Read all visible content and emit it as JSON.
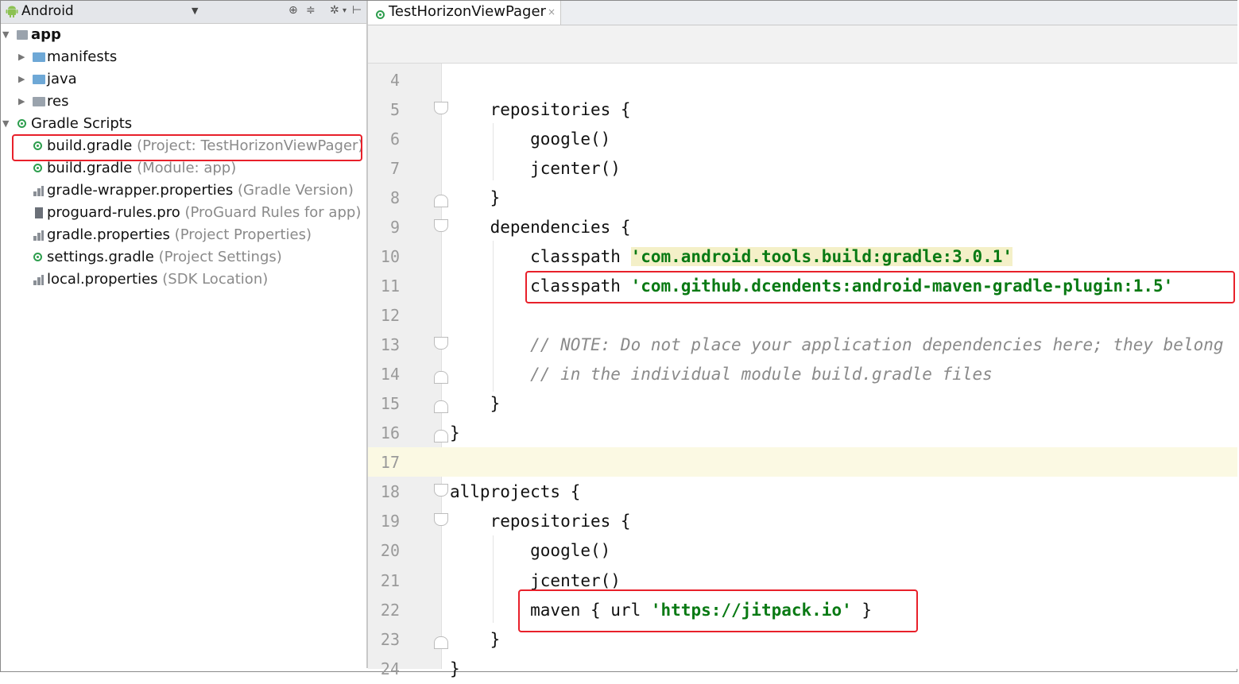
{
  "project_panel": {
    "view_label": "Android",
    "tree": [
      {
        "label": "app",
        "hint": "",
        "icon": "app-module-icon"
      },
      {
        "label": "manifests",
        "hint": "",
        "icon": "folder-icon"
      },
      {
        "label": "java",
        "hint": "",
        "icon": "folder-icon"
      },
      {
        "label": "res",
        "hint": "",
        "icon": "res-folder-icon"
      },
      {
        "label": "Gradle Scripts",
        "hint": "",
        "icon": "gradle-icon"
      },
      {
        "label": "build.gradle",
        "hint": "(Project: TestHorizonViewPager)",
        "icon": "gradle-icon"
      },
      {
        "label": "build.gradle",
        "hint": "(Module: app)",
        "icon": "gradle-icon"
      },
      {
        "label": "gradle-wrapper.properties",
        "hint": "(Gradle Version)",
        "icon": "properties-icon"
      },
      {
        "label": "proguard-rules.pro",
        "hint": "(ProGuard Rules for app)",
        "icon": "file-icon"
      },
      {
        "label": "gradle.properties",
        "hint": "(Project Properties)",
        "icon": "properties-icon"
      },
      {
        "label": "settings.gradle",
        "hint": "(Project Settings)",
        "icon": "gradle-icon"
      },
      {
        "label": "local.properties",
        "hint": "(SDK Location)",
        "icon": "properties-icon"
      }
    ]
  },
  "editor": {
    "tab_label": "TestHorizonViewPager",
    "tab_close": "×",
    "lines": [
      {
        "num": "4",
        "code": ""
      },
      {
        "num": "5",
        "code": "    repositories {"
      },
      {
        "num": "6",
        "code": "        google()"
      },
      {
        "num": "7",
        "code": "        jcenter()"
      },
      {
        "num": "8",
        "code": "    }"
      },
      {
        "num": "9",
        "code": "    dependencies {"
      },
      {
        "num": "10",
        "code": "        classpath ",
        "str": "'com.android.tools.build:gradle:3.0.1'"
      },
      {
        "num": "11",
        "code": "        classpath ",
        "str": "'com.github.dcendents:android-maven-gradle-plugin:1.5'"
      },
      {
        "num": "12",
        "code": ""
      },
      {
        "num": "13",
        "comment": "        // NOTE: Do not place your application dependencies here; they belong"
      },
      {
        "num": "14",
        "comment": "        // in the individual module build.gradle files"
      },
      {
        "num": "15",
        "code": "    }"
      },
      {
        "num": "16",
        "code": "}"
      },
      {
        "num": "17",
        "code": ""
      },
      {
        "num": "18",
        "code": "allprojects {"
      },
      {
        "num": "19",
        "code": "    repositories {"
      },
      {
        "num": "20",
        "code": "        google()"
      },
      {
        "num": "21",
        "code": "        jcenter()"
      },
      {
        "num": "22",
        "code": "        maven { url ",
        "str": "'https://jitpack.io'",
        "tail": " }"
      },
      {
        "num": "23",
        "code": "    }"
      },
      {
        "num": "24",
        "code": "}"
      }
    ]
  },
  "colors": {
    "highlight_box": "#e8202a",
    "string": "#0a7a14",
    "comment": "#8a8a8a",
    "current_line": "#fbf9e3"
  }
}
